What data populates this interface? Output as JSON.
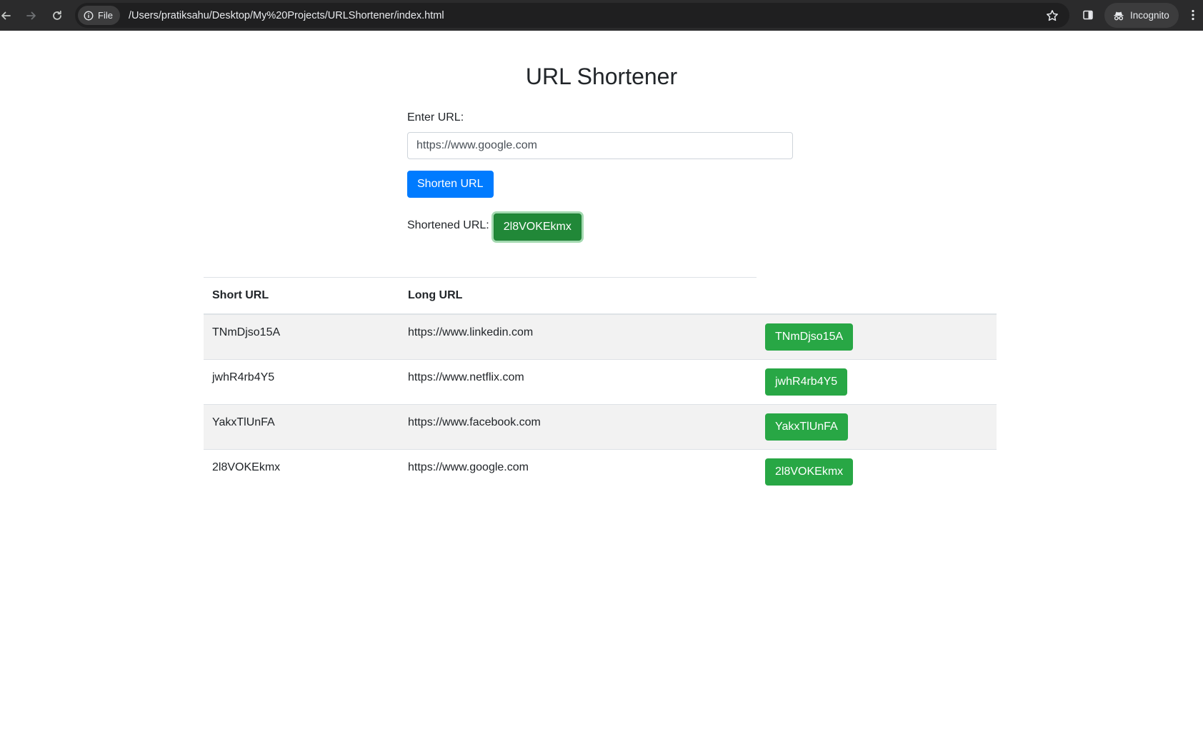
{
  "browser": {
    "file_chip_label": "File",
    "url": "/Users/pratiksahu/Desktop/My%20Projects/URLShortener/index.html",
    "incognito_label": "Incognito"
  },
  "page": {
    "title": "URL Shortener",
    "input_label": "Enter URL:",
    "input_value": "https://www.google.com",
    "shorten_button": "Shorten URL",
    "result_label": "Shortened URL:",
    "result_value": "2l8VOKEkmx"
  },
  "table": {
    "headers": {
      "short": "Short URL",
      "long": "Long URL"
    },
    "rows": [
      {
        "short": "TNmDjso15A",
        "long": "https://www.linkedin.com",
        "button": "TNmDjso15A"
      },
      {
        "short": "jwhR4rb4Y5",
        "long": "https://www.netflix.com",
        "button": "jwhR4rb4Y5"
      },
      {
        "short": "YakxTlUnFA",
        "long": "https://www.facebook.com",
        "button": "YakxTlUnFA"
      },
      {
        "short": "2l8VOKEkmx",
        "long": "https://www.google.com",
        "button": "2l8VOKEkmx"
      }
    ]
  },
  "colors": {
    "primary": "#007bff",
    "success": "#28a745",
    "stripe": "#f2f2f2",
    "chrome_bar": "#2b2b2c"
  },
  "icons": {
    "back": "arrow-left-icon",
    "forward": "arrow-right-icon",
    "reload": "reload-icon",
    "info": "info-icon",
    "bookmark": "star-icon",
    "side_panel": "side-panel-icon",
    "incognito": "incognito-icon",
    "menu": "more-vert-icon"
  }
}
